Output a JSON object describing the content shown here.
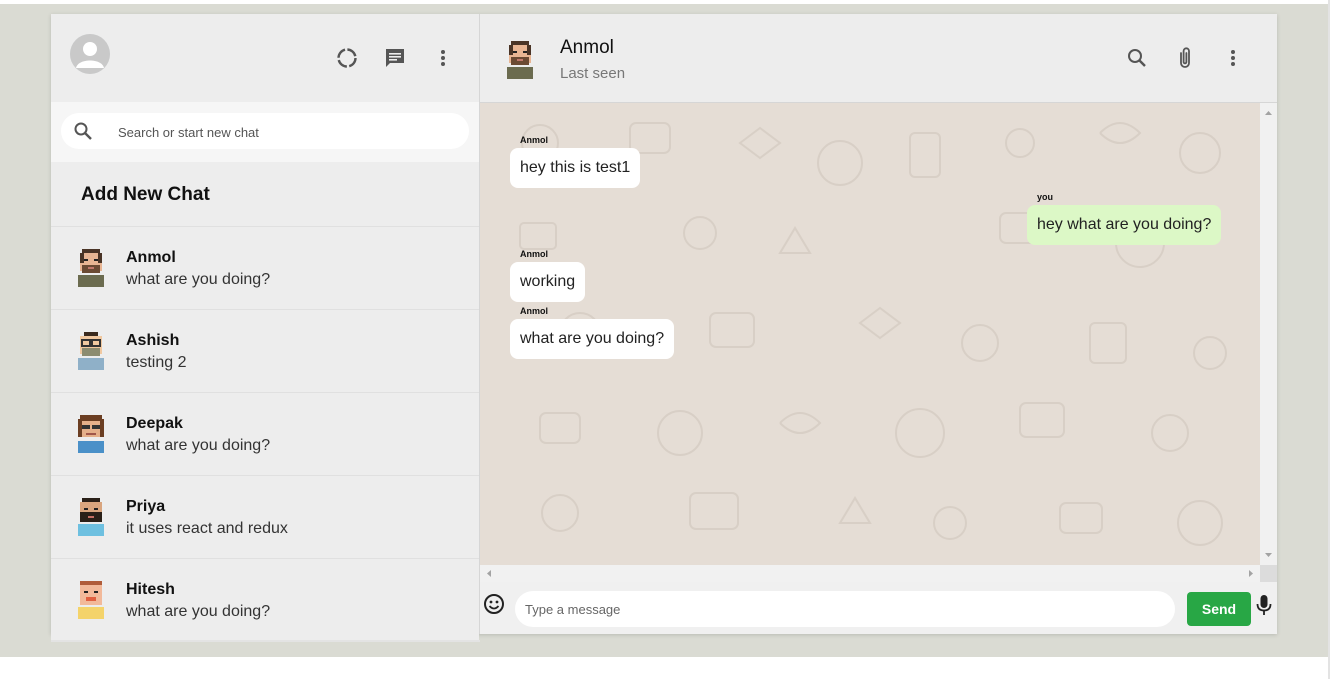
{
  "colors": {
    "accent_green": "#28a745",
    "outgoing_bubble": "#dcf8c6",
    "chat_bg": "#e5ddd5",
    "header_bg": "#ededed"
  },
  "sidebar": {
    "header_icons": [
      "status-icon",
      "new-chat-icon",
      "more-vert-icon"
    ],
    "search": {
      "placeholder": "Search or start new chat",
      "value": ""
    },
    "add_new_chat": "Add New Chat",
    "chats": [
      {
        "name": "Anmol",
        "last_message": "what are you doing?"
      },
      {
        "name": "Ashish",
        "last_message": "testing 2"
      },
      {
        "name": "Deepak",
        "last_message": "what are you doing?"
      },
      {
        "name": "Priya",
        "last_message": "it uses react and redux"
      },
      {
        "name": "Hitesh",
        "last_message": "what are you doing?"
      }
    ]
  },
  "chat": {
    "header": {
      "name": "Anmol",
      "status": "Last seen",
      "icons": [
        "search-icon",
        "attach-icon",
        "more-vert-icon"
      ]
    },
    "messages": [
      {
        "sender": "Anmol",
        "text": "hey this is test1",
        "direction": "in"
      },
      {
        "sender": "you",
        "text": "hey what are you doing?",
        "direction": "out"
      },
      {
        "sender": "Anmol",
        "text": "working",
        "direction": "in"
      },
      {
        "sender": "Anmol",
        "text": "what are you doing?",
        "direction": "in"
      }
    ],
    "composer": {
      "placeholder": "Type a message",
      "value": "",
      "send_label": "Send"
    }
  }
}
